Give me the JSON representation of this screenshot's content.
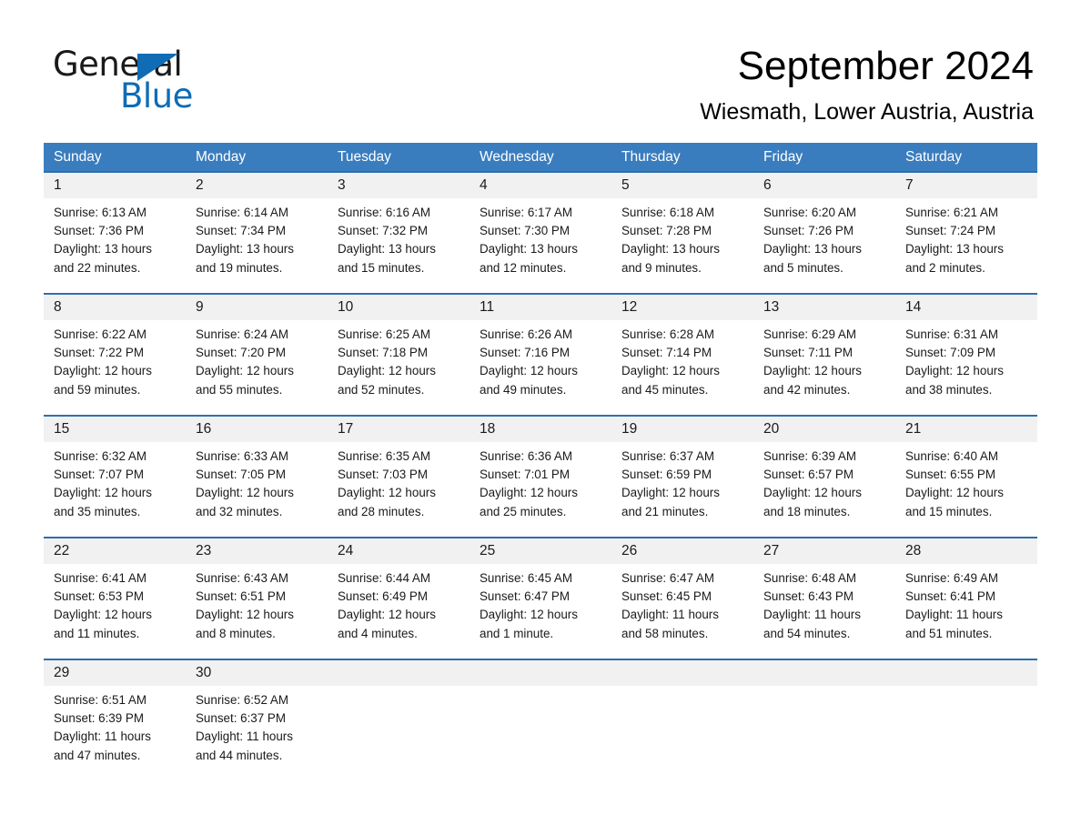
{
  "brand": {
    "name_part1": "General",
    "name_part2": "Blue",
    "flag_icon": "triangle-flag-icon",
    "accent_color": "#0f6cb5"
  },
  "header": {
    "month_title": "September 2024",
    "location": "Wiesmath, Lower Austria, Austria"
  },
  "calendar": {
    "header_bg": "#3a7dbf",
    "day_band_bg": "#f1f1f1",
    "row_rule_color": "#2f6fab",
    "weekdays": [
      "Sunday",
      "Monday",
      "Tuesday",
      "Wednesday",
      "Thursday",
      "Friday",
      "Saturday"
    ],
    "weeks": [
      [
        {
          "day": "1",
          "sunrise": "Sunrise: 6:13 AM",
          "sunset": "Sunset: 7:36 PM",
          "daylight_line1": "Daylight: 13 hours",
          "daylight_line2": "and 22 minutes."
        },
        {
          "day": "2",
          "sunrise": "Sunrise: 6:14 AM",
          "sunset": "Sunset: 7:34 PM",
          "daylight_line1": "Daylight: 13 hours",
          "daylight_line2": "and 19 minutes."
        },
        {
          "day": "3",
          "sunrise": "Sunrise: 6:16 AM",
          "sunset": "Sunset: 7:32 PM",
          "daylight_line1": "Daylight: 13 hours",
          "daylight_line2": "and 15 minutes."
        },
        {
          "day": "4",
          "sunrise": "Sunrise: 6:17 AM",
          "sunset": "Sunset: 7:30 PM",
          "daylight_line1": "Daylight: 13 hours",
          "daylight_line2": "and 12 minutes."
        },
        {
          "day": "5",
          "sunrise": "Sunrise: 6:18 AM",
          "sunset": "Sunset: 7:28 PM",
          "daylight_line1": "Daylight: 13 hours",
          "daylight_line2": "and 9 minutes."
        },
        {
          "day": "6",
          "sunrise": "Sunrise: 6:20 AM",
          "sunset": "Sunset: 7:26 PM",
          "daylight_line1": "Daylight: 13 hours",
          "daylight_line2": "and 5 minutes."
        },
        {
          "day": "7",
          "sunrise": "Sunrise: 6:21 AM",
          "sunset": "Sunset: 7:24 PM",
          "daylight_line1": "Daylight: 13 hours",
          "daylight_line2": "and 2 minutes."
        }
      ],
      [
        {
          "day": "8",
          "sunrise": "Sunrise: 6:22 AM",
          "sunset": "Sunset: 7:22 PM",
          "daylight_line1": "Daylight: 12 hours",
          "daylight_line2": "and 59 minutes."
        },
        {
          "day": "9",
          "sunrise": "Sunrise: 6:24 AM",
          "sunset": "Sunset: 7:20 PM",
          "daylight_line1": "Daylight: 12 hours",
          "daylight_line2": "and 55 minutes."
        },
        {
          "day": "10",
          "sunrise": "Sunrise: 6:25 AM",
          "sunset": "Sunset: 7:18 PM",
          "daylight_line1": "Daylight: 12 hours",
          "daylight_line2": "and 52 minutes."
        },
        {
          "day": "11",
          "sunrise": "Sunrise: 6:26 AM",
          "sunset": "Sunset: 7:16 PM",
          "daylight_line1": "Daylight: 12 hours",
          "daylight_line2": "and 49 minutes."
        },
        {
          "day": "12",
          "sunrise": "Sunrise: 6:28 AM",
          "sunset": "Sunset: 7:14 PM",
          "daylight_line1": "Daylight: 12 hours",
          "daylight_line2": "and 45 minutes."
        },
        {
          "day": "13",
          "sunrise": "Sunrise: 6:29 AM",
          "sunset": "Sunset: 7:11 PM",
          "daylight_line1": "Daylight: 12 hours",
          "daylight_line2": "and 42 minutes."
        },
        {
          "day": "14",
          "sunrise": "Sunrise: 6:31 AM",
          "sunset": "Sunset: 7:09 PM",
          "daylight_line1": "Daylight: 12 hours",
          "daylight_line2": "and 38 minutes."
        }
      ],
      [
        {
          "day": "15",
          "sunrise": "Sunrise: 6:32 AM",
          "sunset": "Sunset: 7:07 PM",
          "daylight_line1": "Daylight: 12 hours",
          "daylight_line2": "and 35 minutes."
        },
        {
          "day": "16",
          "sunrise": "Sunrise: 6:33 AM",
          "sunset": "Sunset: 7:05 PM",
          "daylight_line1": "Daylight: 12 hours",
          "daylight_line2": "and 32 minutes."
        },
        {
          "day": "17",
          "sunrise": "Sunrise: 6:35 AM",
          "sunset": "Sunset: 7:03 PM",
          "daylight_line1": "Daylight: 12 hours",
          "daylight_line2": "and 28 minutes."
        },
        {
          "day": "18",
          "sunrise": "Sunrise: 6:36 AM",
          "sunset": "Sunset: 7:01 PM",
          "daylight_line1": "Daylight: 12 hours",
          "daylight_line2": "and 25 minutes."
        },
        {
          "day": "19",
          "sunrise": "Sunrise: 6:37 AM",
          "sunset": "Sunset: 6:59 PM",
          "daylight_line1": "Daylight: 12 hours",
          "daylight_line2": "and 21 minutes."
        },
        {
          "day": "20",
          "sunrise": "Sunrise: 6:39 AM",
          "sunset": "Sunset: 6:57 PM",
          "daylight_line1": "Daylight: 12 hours",
          "daylight_line2": "and 18 minutes."
        },
        {
          "day": "21",
          "sunrise": "Sunrise: 6:40 AM",
          "sunset": "Sunset: 6:55 PM",
          "daylight_line1": "Daylight: 12 hours",
          "daylight_line2": "and 15 minutes."
        }
      ],
      [
        {
          "day": "22",
          "sunrise": "Sunrise: 6:41 AM",
          "sunset": "Sunset: 6:53 PM",
          "daylight_line1": "Daylight: 12 hours",
          "daylight_line2": "and 11 minutes."
        },
        {
          "day": "23",
          "sunrise": "Sunrise: 6:43 AM",
          "sunset": "Sunset: 6:51 PM",
          "daylight_line1": "Daylight: 12 hours",
          "daylight_line2": "and 8 minutes."
        },
        {
          "day": "24",
          "sunrise": "Sunrise: 6:44 AM",
          "sunset": "Sunset: 6:49 PM",
          "daylight_line1": "Daylight: 12 hours",
          "daylight_line2": "and 4 minutes."
        },
        {
          "day": "25",
          "sunrise": "Sunrise: 6:45 AM",
          "sunset": "Sunset: 6:47 PM",
          "daylight_line1": "Daylight: 12 hours",
          "daylight_line2": "and 1 minute."
        },
        {
          "day": "26",
          "sunrise": "Sunrise: 6:47 AM",
          "sunset": "Sunset: 6:45 PM",
          "daylight_line1": "Daylight: 11 hours",
          "daylight_line2": "and 58 minutes."
        },
        {
          "day": "27",
          "sunrise": "Sunrise: 6:48 AM",
          "sunset": "Sunset: 6:43 PM",
          "daylight_line1": "Daylight: 11 hours",
          "daylight_line2": "and 54 minutes."
        },
        {
          "day": "28",
          "sunrise": "Sunrise: 6:49 AM",
          "sunset": "Sunset: 6:41 PM",
          "daylight_line1": "Daylight: 11 hours",
          "daylight_line2": "and 51 minutes."
        }
      ],
      [
        {
          "day": "29",
          "sunrise": "Sunrise: 6:51 AM",
          "sunset": "Sunset: 6:39 PM",
          "daylight_line1": "Daylight: 11 hours",
          "daylight_line2": "and 47 minutes."
        },
        {
          "day": "30",
          "sunrise": "Sunrise: 6:52 AM",
          "sunset": "Sunset: 6:37 PM",
          "daylight_line1": "Daylight: 11 hours",
          "daylight_line2": "and 44 minutes."
        },
        {
          "day": "",
          "sunrise": "",
          "sunset": "",
          "daylight_line1": "",
          "daylight_line2": ""
        },
        {
          "day": "",
          "sunrise": "",
          "sunset": "",
          "daylight_line1": "",
          "daylight_line2": ""
        },
        {
          "day": "",
          "sunrise": "",
          "sunset": "",
          "daylight_line1": "",
          "daylight_line2": ""
        },
        {
          "day": "",
          "sunrise": "",
          "sunset": "",
          "daylight_line1": "",
          "daylight_line2": ""
        },
        {
          "day": "",
          "sunrise": "",
          "sunset": "",
          "daylight_line1": "",
          "daylight_line2": ""
        }
      ]
    ]
  }
}
